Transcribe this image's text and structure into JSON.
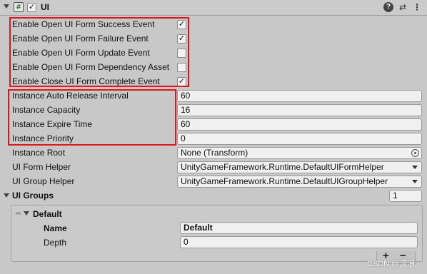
{
  "header": {
    "title": "UI",
    "enabled_check": "✓",
    "script_glyph": "#"
  },
  "events": [
    {
      "label": "Enable Open UI Form Success Event",
      "checked": "✓"
    },
    {
      "label": "Enable Open UI Form Failure Event",
      "checked": "✓"
    },
    {
      "label": "Enable Open UI Form Update Event",
      "checked": ""
    },
    {
      "label": "Enable Open UI Form Dependency Asset",
      "checked": ""
    },
    {
      "label": "Enable Close UI Form Complete Event",
      "checked": "✓"
    }
  ],
  "instance": [
    {
      "label": "Instance Auto Release Interval",
      "value": "60"
    },
    {
      "label": "Instance Capacity",
      "value": "16"
    },
    {
      "label": "Instance Expire Time",
      "value": "60"
    },
    {
      "label": "Instance Priority",
      "value": "0"
    }
  ],
  "instance_root": {
    "label": "Instance Root",
    "value": "None (Transform)"
  },
  "helpers": [
    {
      "label": "UI Form Helper",
      "value": "UnityGameFramework.Runtime.DefaultUIFormHelper"
    },
    {
      "label": "UI Group Helper",
      "value": "UnityGameFramework.Runtime.DefaultUIGroupHelper"
    }
  ],
  "ui_groups": {
    "label": "UI Groups",
    "count": "1",
    "item": {
      "title": "Default",
      "name_label": "Name",
      "name_value": "Default",
      "depth_label": "Depth",
      "depth_value": "0"
    },
    "add_label": "+",
    "remove_label": "−"
  },
  "watermark": "CSDN @流浪",
  "colors": {
    "highlight_box": "#e0161d"
  }
}
